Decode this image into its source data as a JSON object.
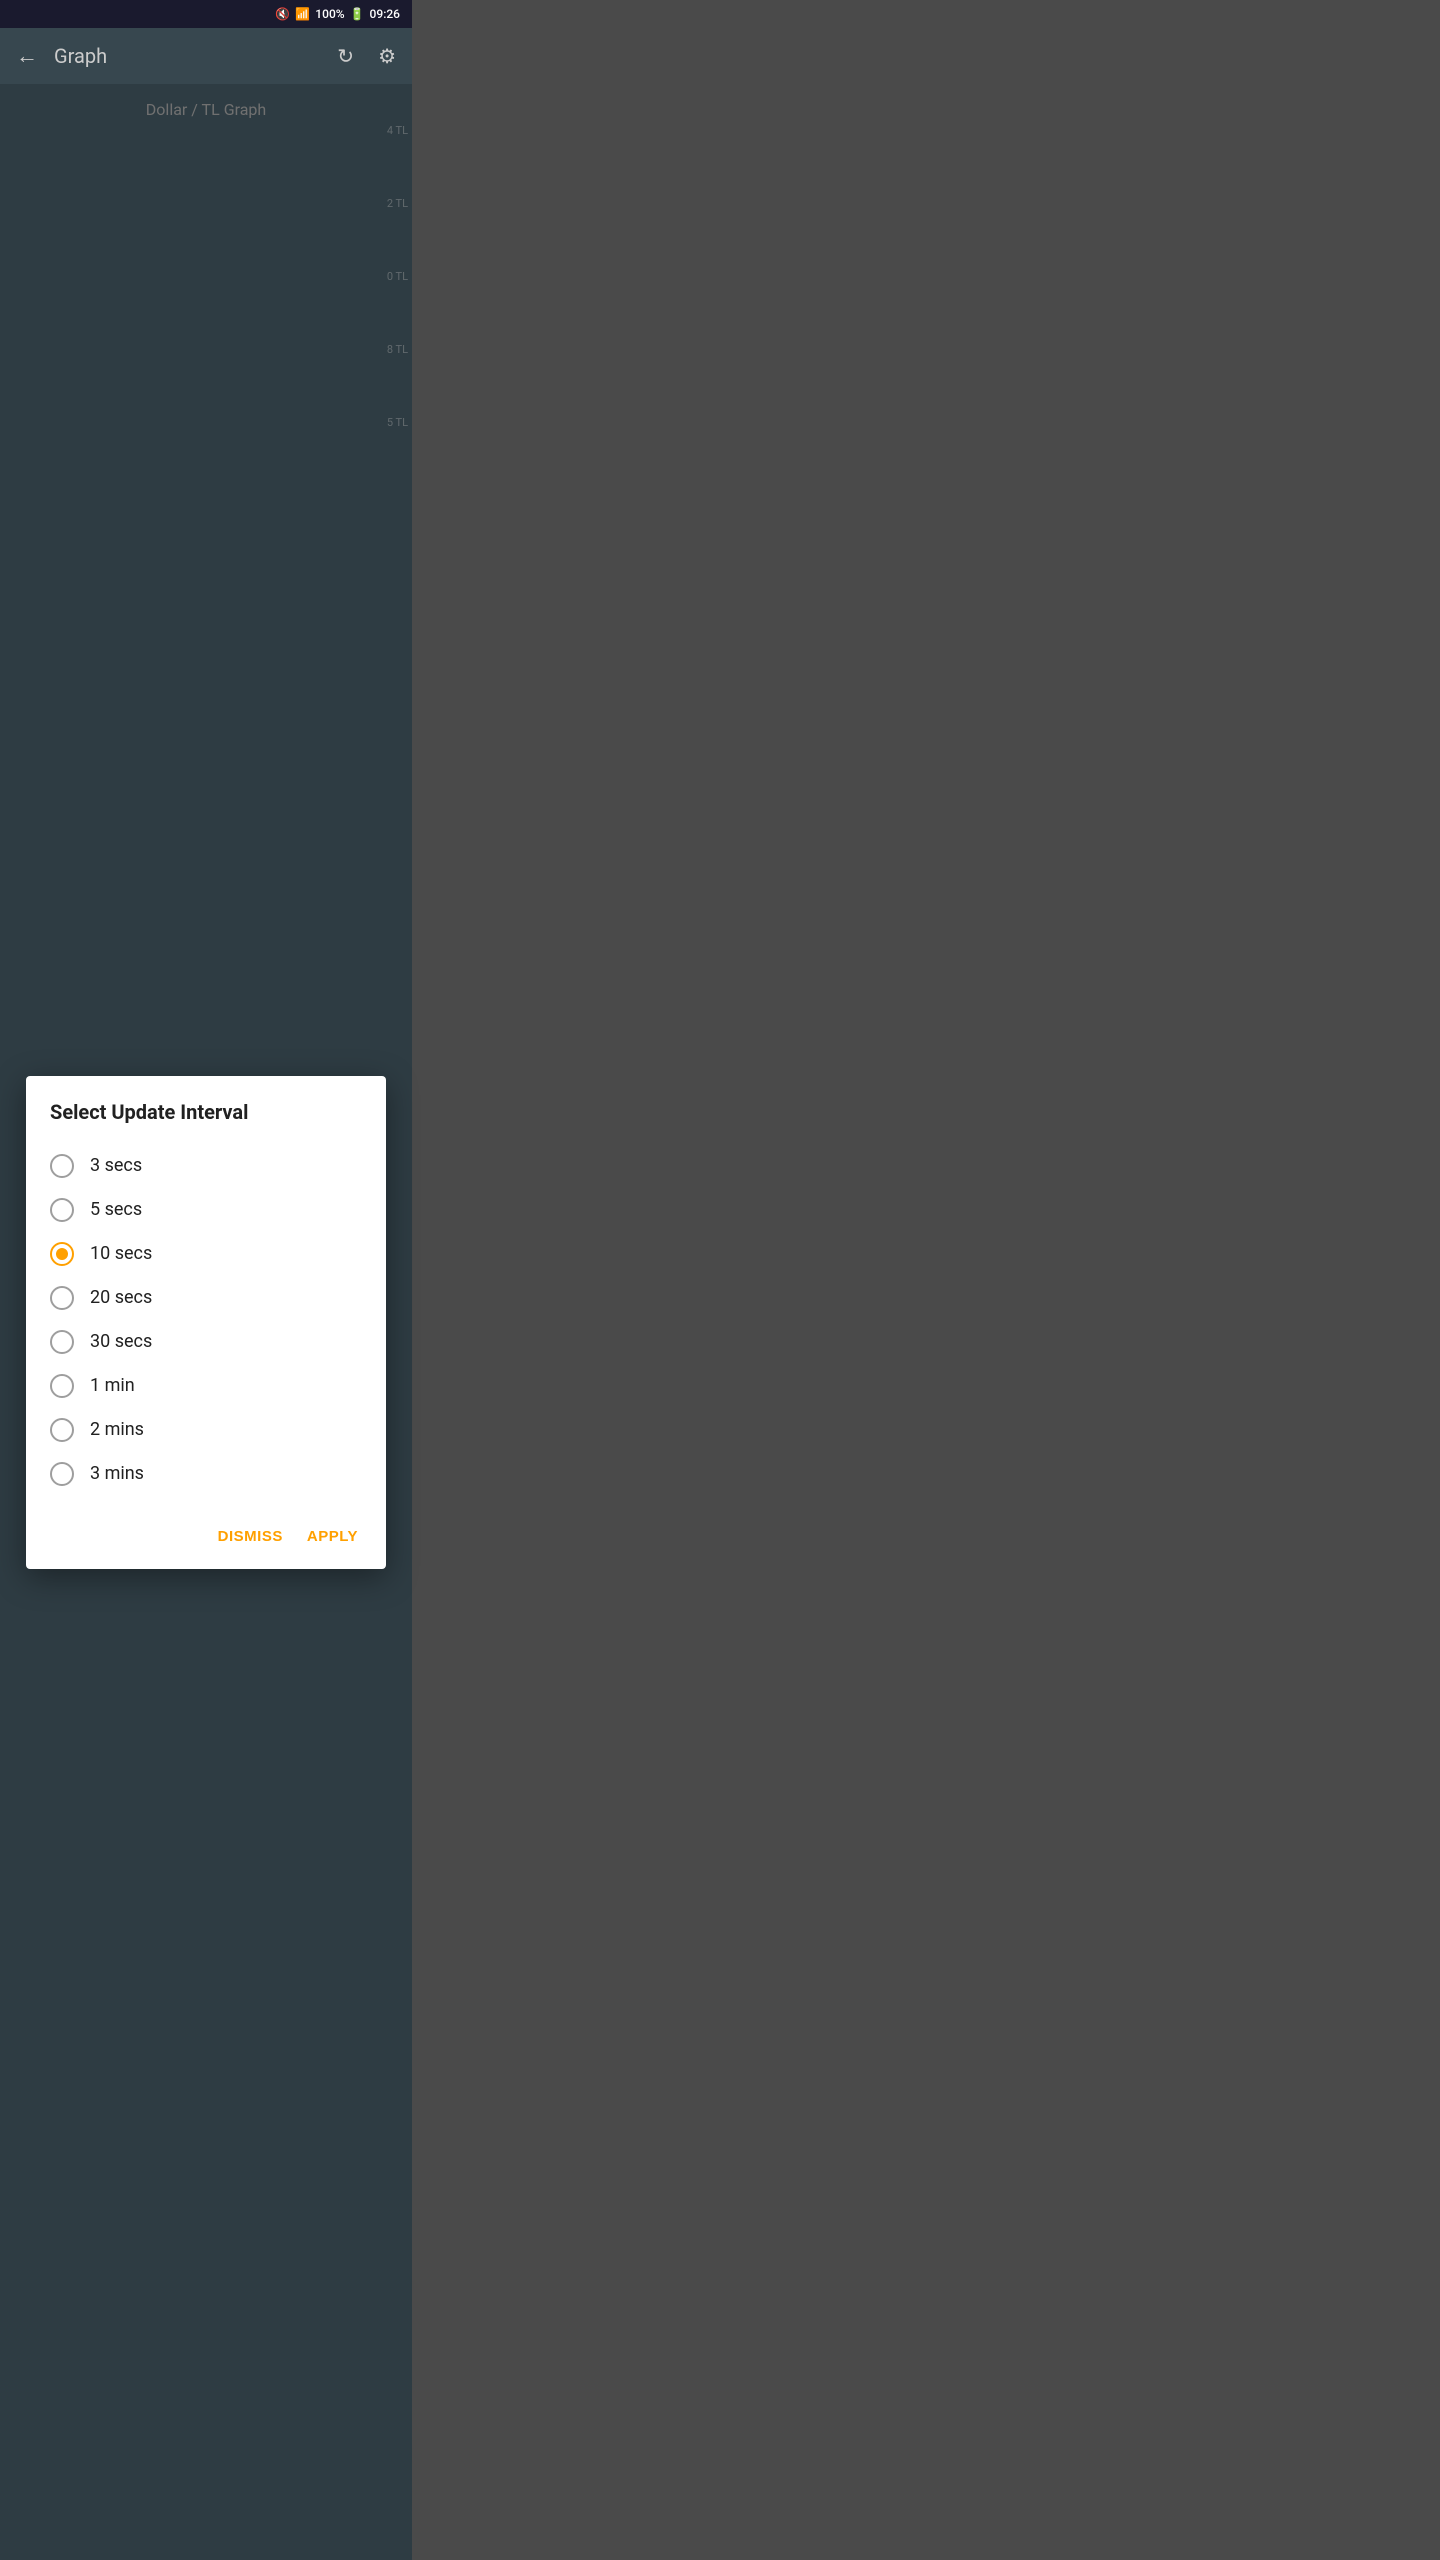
{
  "statusBar": {
    "time": "09:26",
    "battery": "100%",
    "icons": [
      "mute-icon",
      "wifi-icon",
      "signal-icon",
      "battery-icon"
    ]
  },
  "appBar": {
    "title": "Graph",
    "backLabel": "←",
    "refreshIcon": "↻",
    "settingsIcon": "⚙"
  },
  "background": {
    "subtitle": "Dollar / TL Graph",
    "axisLabels": [
      "4 TL",
      "2 TL",
      "0 TL",
      "8 TL",
      "5 TL"
    ]
  },
  "dialog": {
    "title": "Select Update Interval",
    "options": [
      {
        "id": "3s",
        "label": "3 secs",
        "selected": false
      },
      {
        "id": "5s",
        "label": "5 secs",
        "selected": false
      },
      {
        "id": "10s",
        "label": "10 secs",
        "selected": true
      },
      {
        "id": "20s",
        "label": "20 secs",
        "selected": false
      },
      {
        "id": "30s",
        "label": "30 secs",
        "selected": false
      },
      {
        "id": "1m",
        "label": "1 min",
        "selected": false
      },
      {
        "id": "2m",
        "label": "2 mins",
        "selected": false
      },
      {
        "id": "3m",
        "label": "3 mins",
        "selected": false
      }
    ],
    "dismissLabel": "DISMISS",
    "applyLabel": "APPLY"
  }
}
